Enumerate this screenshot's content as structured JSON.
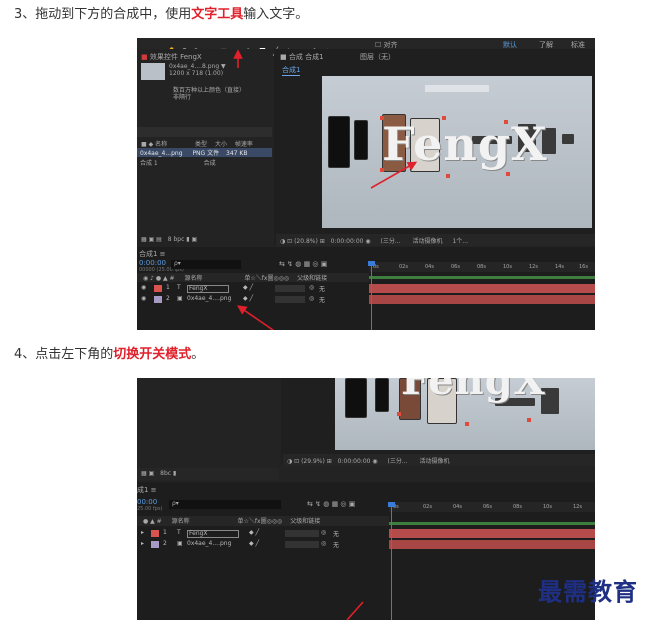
{
  "step3": {
    "prefix": "3、拖动到下方的合成中，使用",
    "highlight": "文字工具",
    "suffix": "输入文字。"
  },
  "step4": {
    "prefix": "4、点击左下角的",
    "highlight": "切换开关模式",
    "suffix": "。"
  },
  "shot1": {
    "project_title": "效果控件 FengX",
    "file_name": "0x4ae_4....8.png ▼",
    "file_info": "1200 x 718 (1.00)",
    "desc1": "数百万种以上颜色（直接）",
    "desc2": "非隔行",
    "col_name": "名称",
    "col_type": "类型",
    "col_size": "大小",
    "col_rate": "帧速率",
    "row1_name": "0x4ae_4...png",
    "row1_type": "PNG 文件",
    "row1_size": "347 KB",
    "row2_name": "合成 1",
    "row2_type": "合成",
    "bpc": "8 bpc",
    "comp_tab": "合成 合成1",
    "layer_tab": "图层（无）",
    "comp_breadcrumb": "合成1",
    "align": "对齐",
    "standard": "默认",
    "learn": "了解",
    "std": "标准",
    "fengx": "FengX",
    "zoom": "(20.8%)",
    "timecode": "0:00:00:00",
    "resolution": "(三分...",
    "camera": "活动摄像机",
    "views": "1个...",
    "timeline_tab": "合成1 ≡",
    "tl_timecode": "0:00:00",
    "tl_fps": "00000 (25.00 fps)",
    "search_placeholder": "ρ▾",
    "tl_col_name": "源名称",
    "tl_col_switch": "单☆＼fx圖◎◎◎",
    "tl_col_parent": "父级和链接",
    "layer1_num": "1",
    "layer1_name": "FengX",
    "layer1_parent": "无",
    "layer2_num": "2",
    "layer2_name": "0x4ae_4....png",
    "layer2_parent": "无",
    "ruler": [
      "0s",
      "02s",
      "04s",
      "06s",
      "08s",
      "10s",
      "12s",
      "14s",
      "16s"
    ]
  },
  "shot2": {
    "fengx": "FengX",
    "zoom": "(29.9%)",
    "timecode": "0:00:00:00",
    "resolution": "(三分...",
    "camera": "活动摄像机",
    "bpc": "8bc",
    "timeline_tab": "成1 ≡",
    "tl_timecode": "00:00",
    "tl_fps": "25.00 fps)",
    "search_placeholder": "ρ▾",
    "tl_col_name": "源名称",
    "tl_col_switch": "单☆＼fx圖◎◎◎",
    "tl_col_parent": "父级和链接",
    "layer1_num": "1",
    "layer1_name": "FengX",
    "layer1_parent": "无",
    "layer2_num": "2",
    "layer2_name": "0x4ae_4....png",
    "layer2_parent": "无",
    "ruler": [
      "0s",
      "02s",
      "04s",
      "06s",
      "08s",
      "10s",
      "12s"
    ]
  },
  "watermark": "最需教育",
  "colors": {
    "highlight": "#e0202a",
    "arrow": "#e0202a",
    "watermark": "#1e2f84",
    "playhead": "#3b7bd8"
  }
}
